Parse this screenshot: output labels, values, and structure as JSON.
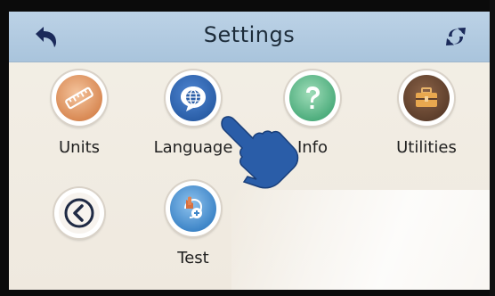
{
  "header": {
    "title": "Settings",
    "back_icon": "back-arrow-icon",
    "refresh_icon": "refresh-icon"
  },
  "menu": {
    "items": [
      {
        "label": "Units",
        "icon": "ruler-icon",
        "color": "#d98a55"
      },
      {
        "label": "Language",
        "icon": "globe-speech-icon",
        "color": "#2b5fa8"
      },
      {
        "label": "Info",
        "icon": "question-icon",
        "color": "#4fae7e"
      },
      {
        "label": "Utilities",
        "icon": "toolbox-icon",
        "color": "#5e3f2c"
      },
      {
        "label": "",
        "icon": "chevron-left-icon",
        "color": "#1f2a44"
      },
      {
        "label": "Test",
        "icon": "test-icon",
        "color": "#3f86c8"
      }
    ]
  },
  "colors": {
    "header_bg": "#b3cbe1",
    "screen_bg": "#f1ece3",
    "text": "#1f1f1f",
    "hand": "#2a5da8"
  }
}
